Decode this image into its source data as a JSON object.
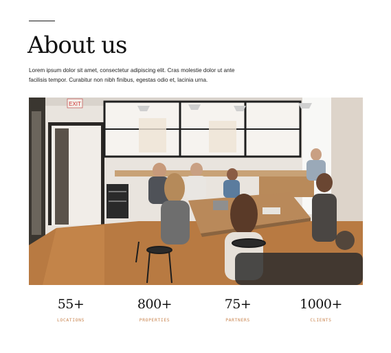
{
  "about": {
    "title": "About us",
    "intro": "Lorem ipsum dolor sit amet, consectetur adipiscing elit. Cras molestie dolor ut ante facilisis tempor. Curabitur non nibh finibus, egestas odio et, lacinia urna."
  },
  "photo": {
    "exit_sign": "EXIT"
  },
  "stats": [
    {
      "value": "55+",
      "label": "LOCATIONS"
    },
    {
      "value": "800+",
      "label": "PROPERTIES"
    },
    {
      "value": "75+",
      "label": "PARTNERS"
    },
    {
      "value": "1000+",
      "label": "CLIENTS"
    }
  ],
  "colors": {
    "accent": "#c9844f",
    "text": "#111111"
  }
}
